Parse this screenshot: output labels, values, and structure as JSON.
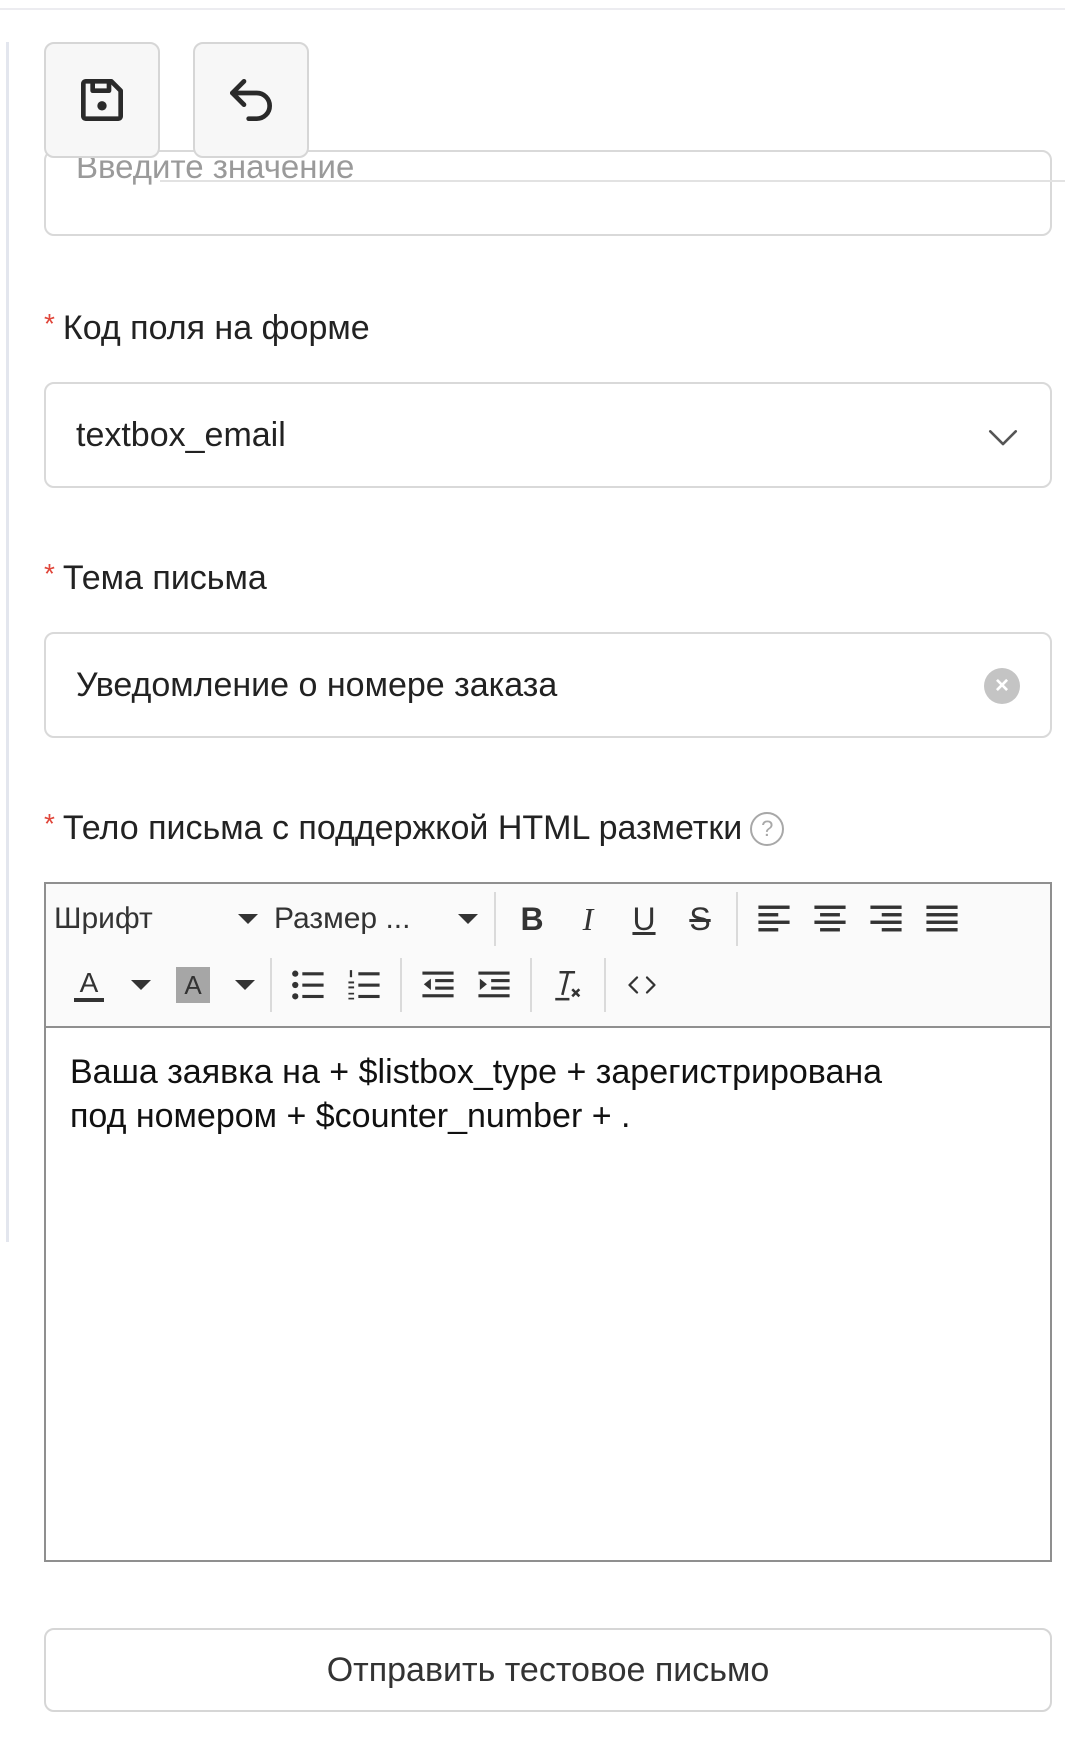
{
  "toolbar": {
    "save_icon": "save-icon",
    "undo_icon": "undo-icon"
  },
  "clipped_input": {
    "placeholder": "Введите значение"
  },
  "form_field_code": {
    "required_mark": "*",
    "label": "Код поля на форме",
    "value": "textbox_email",
    "icon": "chevron-down-icon"
  },
  "subject": {
    "required_mark": "*",
    "label": "Тема письма",
    "value": "Уведомление о номере заказа",
    "clear_icon": "clear-icon"
  },
  "body": {
    "required_mark": "*",
    "label": "Тело письма с поддержкой HTML разметки",
    "help_glyph": "?",
    "editor": {
      "font_dropdown": "Шрифт",
      "size_dropdown": "Размер ...",
      "buttons": [
        "bold",
        "italic",
        "underline",
        "strikethrough",
        "align-left",
        "align-center",
        "align-right",
        "align-justify",
        "text-color",
        "background-color",
        "bullet-list",
        "numbered-list",
        "outdent",
        "indent",
        "clear-format",
        "source-code"
      ],
      "bold_glyph": "B",
      "italic_glyph": "I",
      "underline_glyph": "U",
      "strike_glyph": "S",
      "text_color_glyph": "A",
      "bg_color_glyph": "A",
      "content_lines": [
        "Ваша заявка на + $listbox_type + зарегистрирована",
        "под номером + $counter_number + ."
      ]
    }
  },
  "send_test_label": "Отправить тестовое письмо",
  "colors": {
    "required": "#e0463a",
    "border": "#d9d9d9",
    "editor_border": "#8f8f8f"
  }
}
